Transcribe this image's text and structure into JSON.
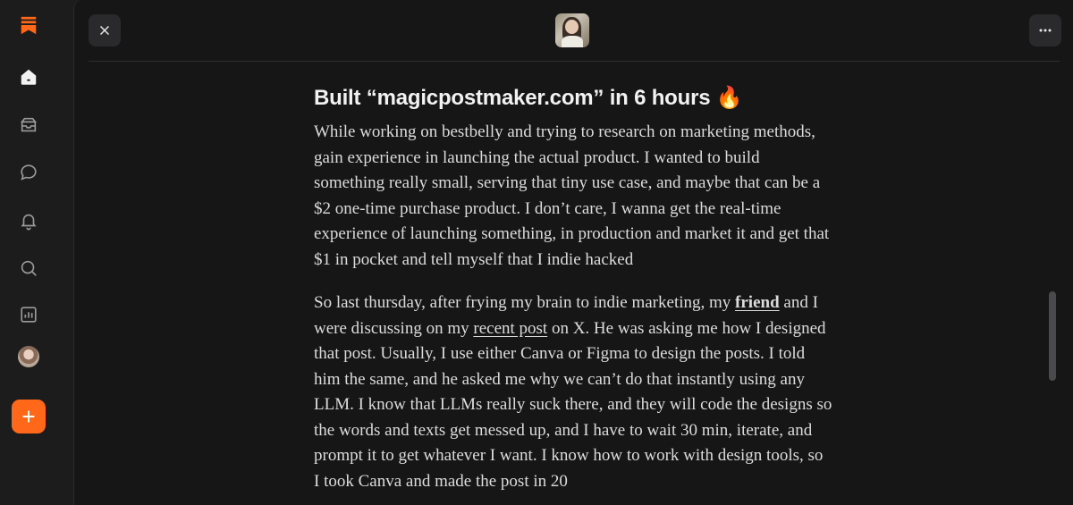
{
  "nav": {
    "items": [
      {
        "name": "home",
        "icon": "home-icon"
      },
      {
        "name": "inbox",
        "icon": "inbox-icon"
      },
      {
        "name": "chat",
        "icon": "chat-icon"
      },
      {
        "name": "activity",
        "icon": "bell-icon"
      },
      {
        "name": "search",
        "icon": "search-icon"
      },
      {
        "name": "stats",
        "icon": "stats-icon"
      }
    ],
    "compose_icon": "plus-icon",
    "logo_icon": "substack-logo-icon",
    "accent": "#ff6719"
  },
  "header": {
    "close_icon": "close-icon",
    "more_icon": "more-horizontal-icon"
  },
  "post": {
    "title": "Built “magicpostmaker.com” in 6 hours 🔥",
    "p1": "While working on bestbelly and trying to research on marketing methods, gain experience in launching the actual product. I wanted to build something really small, serving that tiny use case, and maybe that can be a $2 one-time purchase product. I don’t care, I wanna get the real-time experience of launching something, in production and market it and get that $1 in pocket and tell myself that I indie hacked",
    "p2_a": "So last thursday, after frying my brain to indie marketing, my ",
    "p2_link1": "friend",
    "p2_b": " and I were discussing on my ",
    "p2_link2": "recent post",
    "p2_c": " on X. He was asking me how I designed that post. Usually, I use either Canva or Figma to design the posts. I told him the same, and he asked me why we can’t do that instantly using any LLM. I know that LLMs really suck there, and they will code the designs so the words and texts get messed up, and I have to wait 30 min, iterate, and prompt it to get whatever I want. I know how to work with design tools, so I took Canva and made the post in 20"
  }
}
